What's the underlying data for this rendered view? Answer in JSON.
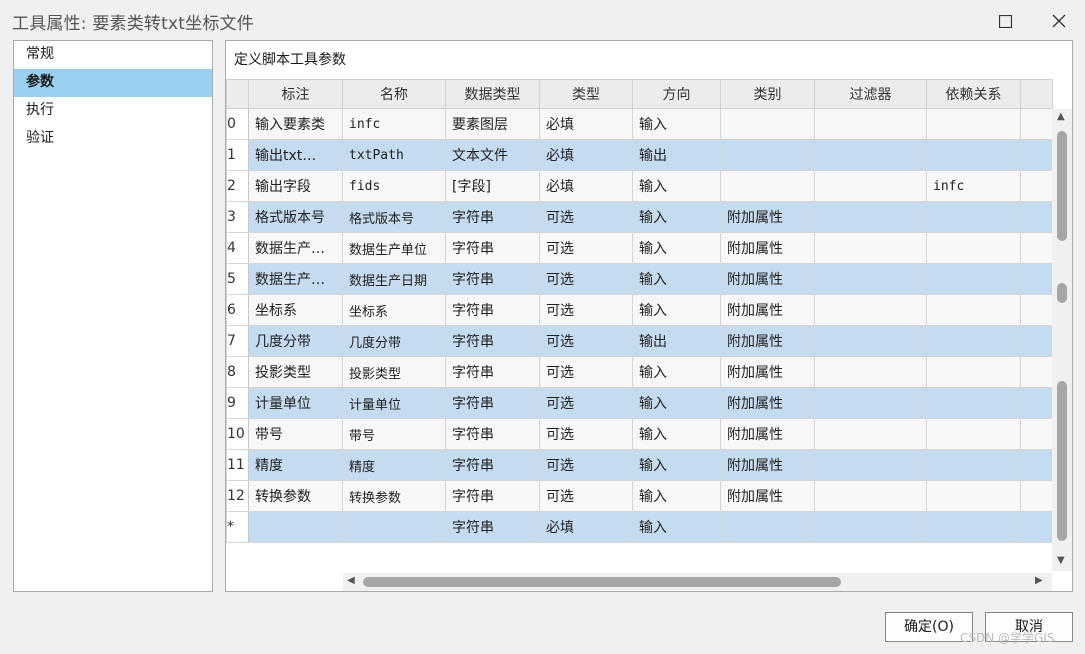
{
  "window": {
    "title": "工具属性: 要素类转txt坐标文件"
  },
  "nav": {
    "items": [
      {
        "label": "常规",
        "active": false
      },
      {
        "label": "参数",
        "active": true
      },
      {
        "label": "执行",
        "active": false
      },
      {
        "label": "验证",
        "active": false
      }
    ]
  },
  "panel": {
    "label": "定义脚本工具参数"
  },
  "grid": {
    "columns": [
      "",
      "标注",
      "名称",
      "数据类型",
      "类型",
      "方向",
      "类别",
      "过滤器",
      "依赖关系"
    ],
    "rows": [
      [
        "0",
        "输入要素类",
        "infc",
        "要素图层",
        "必填",
        "输入",
        "",
        "",
        ""
      ],
      [
        "1",
        "输出txt…",
        "txtPath",
        "文本文件",
        "必填",
        "输出",
        "",
        "",
        ""
      ],
      [
        "2",
        "输出字段",
        "fids",
        "[字段]",
        "必填",
        "输入",
        "",
        "",
        "infc"
      ],
      [
        "3",
        "格式版本号",
        "格式版本号",
        "字符串",
        "可选",
        "输入",
        "附加属性",
        "",
        ""
      ],
      [
        "4",
        "数据生产…",
        "数据生产单位",
        "字符串",
        "可选",
        "输入",
        "附加属性",
        "",
        ""
      ],
      [
        "5",
        "数据生产…",
        "数据生产日期",
        "字符串",
        "可选",
        "输入",
        "附加属性",
        "",
        ""
      ],
      [
        "6",
        "坐标系",
        "坐标系",
        "字符串",
        "可选",
        "输入",
        "附加属性",
        "",
        ""
      ],
      [
        "7",
        "几度分带",
        "几度分带",
        "字符串",
        "可选",
        "输出",
        "附加属性",
        "",
        ""
      ],
      [
        "8",
        "投影类型",
        "投影类型",
        "字符串",
        "可选",
        "输入",
        "附加属性",
        "",
        ""
      ],
      [
        "9",
        "计量单位",
        "计量单位",
        "字符串",
        "可选",
        "输入",
        "附加属性",
        "",
        ""
      ],
      [
        "10",
        "带号",
        "带号",
        "字符串",
        "可选",
        "输入",
        "附加属性",
        "",
        ""
      ],
      [
        "11",
        "精度",
        "精度",
        "字符串",
        "可选",
        "输入",
        "附加属性",
        "",
        ""
      ],
      [
        "12",
        "转换参数",
        "转换参数",
        "字符串",
        "可选",
        "输入",
        "附加属性",
        "",
        ""
      ],
      [
        "*",
        "",
        "",
        "字符串",
        "必填",
        "输入",
        "",
        "",
        ""
      ]
    ]
  },
  "buttons": {
    "ok": "确定(O)",
    "cancel": "取消"
  },
  "watermark": "CSDN @学学GIS"
}
